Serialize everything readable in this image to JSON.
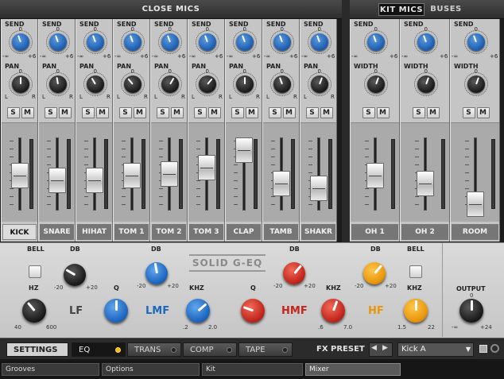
{
  "header": {
    "close_mics": "CLOSE MICS",
    "kit_mics_tab": "KIT MICS",
    "buses_tab": "BUSES"
  },
  "labels": {
    "send": "SEND",
    "pan": "PAN",
    "width": "WIDTH",
    "zero": "0",
    "minus_inf": "-∞",
    "plus6": "+6",
    "l": "L",
    "r": "R",
    "solo": "S",
    "mute": "M"
  },
  "channels": [
    {
      "name": "KICK",
      "selected": true
    },
    {
      "name": "SNARE"
    },
    {
      "name": "HIHAT"
    },
    {
      "name": "TOM 1"
    },
    {
      "name": "TOM 2"
    },
    {
      "name": "TOM 3"
    },
    {
      "name": "CLAP"
    },
    {
      "name": "TAMB"
    },
    {
      "name": "SHAKR"
    }
  ],
  "kit_channels": [
    {
      "name": "OH 1"
    },
    {
      "name": "OH 2"
    },
    {
      "name": "ROOM"
    }
  ],
  "eq": {
    "logo": "SOLID G-EQ",
    "bell": "BELL",
    "db": "DB",
    "hz": "HZ",
    "q": "Q",
    "khz": "KHZ",
    "output": "OUTPUT",
    "lf": "LF",
    "lmf": "LMF",
    "hmf": "HMF",
    "hf": "HF",
    "r_m20": "-20",
    "r_p20": "+20",
    "r_40": "40",
    "r_600": "600",
    "r_2": ".2",
    "r_20": "2.0",
    "r_6": ".6",
    "r_70": "7.0",
    "r_15": "1.5",
    "r_22": "22",
    "r_minf": "-∞",
    "r_p24": "+24",
    "r_0": "0",
    "colors": {
      "lf": "#222222",
      "lmf": "#1e67c0",
      "hmf": "#c2261c",
      "hf": "#e9960b"
    }
  },
  "tabs": {
    "settings": "SETTINGS",
    "eq": "EQ",
    "trans": "TRANS",
    "comp": "COMP",
    "tape": "TAPE",
    "fx_preset_label": "FX PRESET",
    "preset_value": "Kick A"
  },
  "statusbar": {
    "grooves": "Grooves",
    "options": "Options",
    "kit": "Kit",
    "mixer": "Mixer"
  }
}
